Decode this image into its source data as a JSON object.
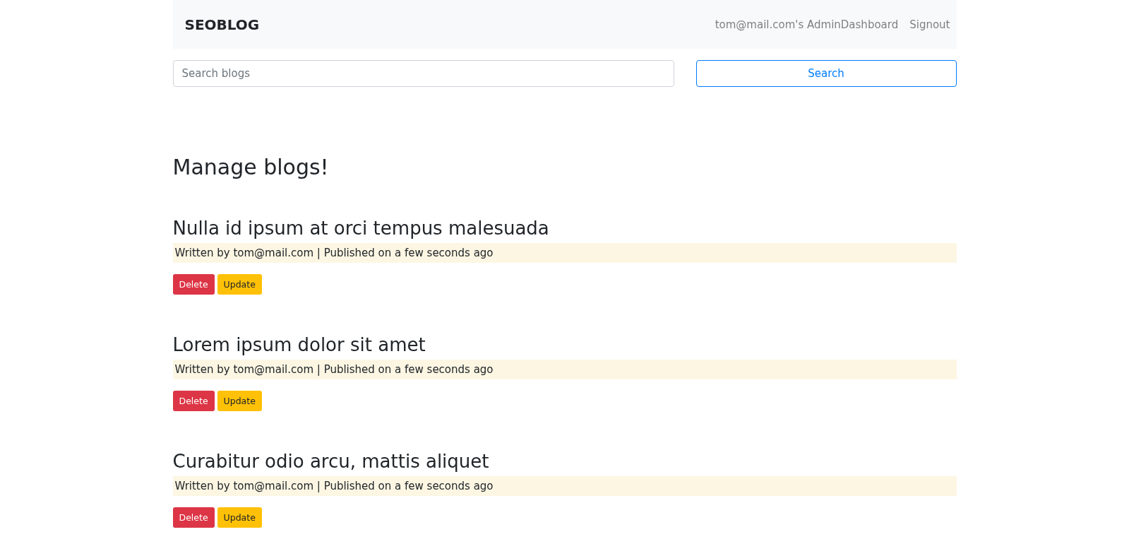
{
  "navbar": {
    "brand": "SEOBLOG",
    "links": [
      "tom@mail.com's AdminDashboard",
      "Signout"
    ]
  },
  "search": {
    "placeholder": "Search blogs",
    "button": "Search"
  },
  "heading": "Manage blogs!",
  "blogs": [
    {
      "title": "Nulla id ipsum at orci tempus malesuada",
      "meta": "Written by tom@mail.com | Published on a few seconds ago",
      "actions": [
        "Delete",
        "Update"
      ]
    },
    {
      "title": "Lorem ipsum dolor sit amet",
      "meta": "Written by tom@mail.com | Published on a few seconds ago",
      "actions": [
        "Delete",
        "Update"
      ]
    },
    {
      "title": "Curabitur odio arcu, mattis aliquet",
      "meta": "Written by tom@mail.com | Published on a few seconds ago",
      "actions": [
        "Delete",
        "Update"
      ]
    }
  ]
}
